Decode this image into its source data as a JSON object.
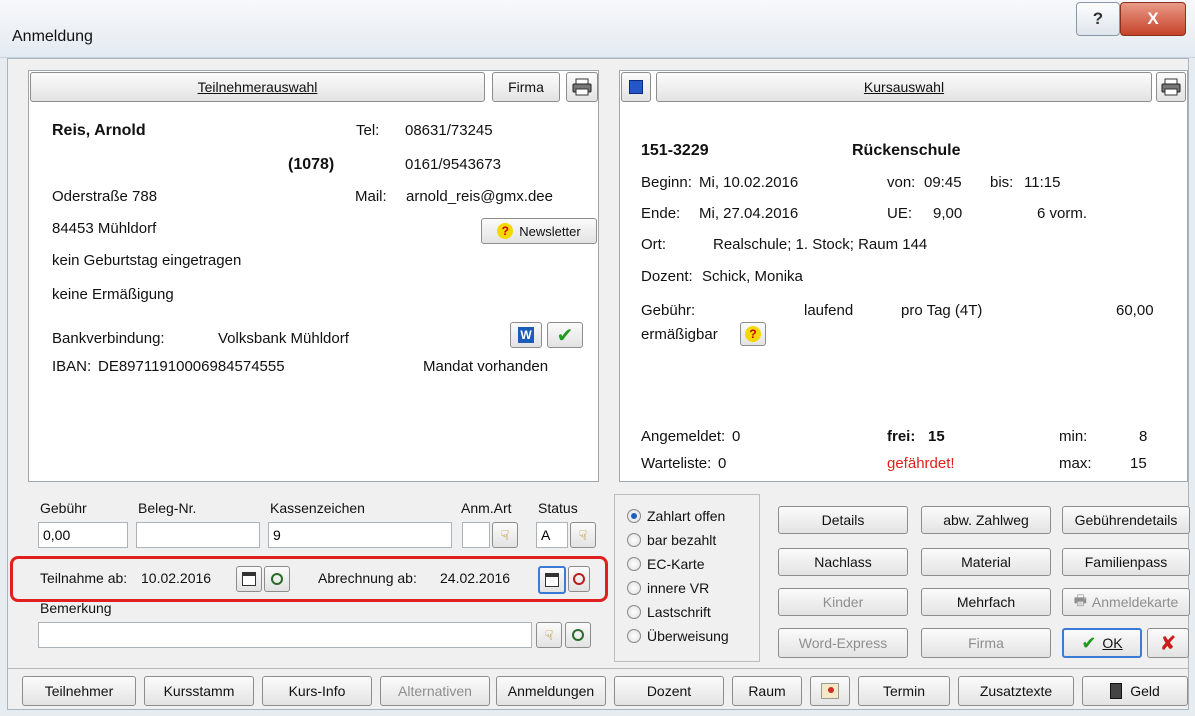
{
  "window": {
    "title": "Anmeldung",
    "help_glyph": "?",
    "close_glyph": "X"
  },
  "participant": {
    "select_button": "Teilnehmerauswahl",
    "firma_button": "Firma",
    "name": "Reis, Arnold",
    "id": "(1078)",
    "tel_label": "Tel:",
    "tel1": "08631/73245",
    "tel2": "0161/9543673",
    "street": "Oderstraße 788",
    "mail_label": "Mail:",
    "mail": "arnold_reis@gmx.dee",
    "city": "84453 Mühldorf",
    "newsletter_label": "Newsletter",
    "birthday": "kein Geburtstag eingetragen",
    "discount": "keine Ermäßigung",
    "bank_label": "Bankverbindung:",
    "bank_name": "Volksbank Mühldorf",
    "iban_label": "IBAN:",
    "iban": "DE89711910006984574555",
    "mandate": "Mandat vorhanden"
  },
  "course": {
    "select_button": "Kursauswahl",
    "number": "151-3229",
    "title": "Rückenschule",
    "begin_label": "Beginn:",
    "begin": "Mi, 10.02.2016",
    "from_label": "von:",
    "from": "09:45",
    "to_label": "bis:",
    "to": "11:15",
    "end_label": "Ende:",
    "end": "Mi, 27.04.2016",
    "ue_label": "UE:",
    "ue": "9,00",
    "slot": "6 vorm.",
    "place_label": "Ort:",
    "place": "Realschule; 1. Stock; Raum 144",
    "teacher_label": "Dozent:",
    "teacher": "Schick, Monika",
    "fee_label": "Gebühr:",
    "fee_type": "laufend",
    "fee_unit": "pro Tag (4T)",
    "fee_amount": "60,00",
    "reducible": "ermäßigbar",
    "registered_label": "Angemeldet:",
    "registered": "0",
    "free_label": "frei:",
    "free": "15",
    "min_label": "min:",
    "min": "8",
    "waitlist_label": "Warteliste:",
    "waitlist": "0",
    "status": "gefährdet!",
    "max_label": "max:",
    "max": "15"
  },
  "form": {
    "fee_label": "Gebühr",
    "fee_value": "0,00",
    "receipt_label": "Beleg-Nr.",
    "receipt_value": "",
    "cash_label": "Kassenzeichen",
    "cash_value": "9",
    "regtype_label": "Anm.Art",
    "regtype_value": "",
    "status_label": "Status",
    "status_value": "A",
    "participation_label": "Teilnahme ab:",
    "participation_date": "10.02.2016",
    "billing_label": "Abrechnung ab:",
    "billing_date": "24.02.2016",
    "remark_label": "Bemerkung",
    "remark_value": ""
  },
  "payment_options": [
    {
      "label": "Zahlart offen",
      "checked": true
    },
    {
      "label": "bar bezahlt",
      "checked": false
    },
    {
      "label": "EC-Karte",
      "checked": false
    },
    {
      "label": "innere VR",
      "checked": false
    },
    {
      "label": "Lastschrift",
      "checked": false
    },
    {
      "label": "Überweisung",
      "checked": false
    }
  ],
  "action_buttons": {
    "details": "Details",
    "alt_payment": "abw. Zahlweg",
    "fee_details": "Gebührendetails",
    "discount": "Nachlass",
    "material": "Material",
    "family_pass": "Familienpass",
    "children": "Kinder",
    "multiple": "Mehrfach",
    "reg_card": "Anmeldekarte",
    "word_express": "Word-Express",
    "company": "Firma",
    "ok": "OK",
    "cancel_glyph": "✘"
  },
  "toolbar": {
    "participants": "Teilnehmer",
    "course_master": "Kursstamm",
    "course_info": "Kurs-Info",
    "alternatives": "Alternativen",
    "registrations": "Anmeldungen",
    "teacher": "Dozent",
    "room": "Raum",
    "schedule": "Termin",
    "extra_texts": "Zusatztexte",
    "money": "Geld"
  },
  "colors": {
    "warning_red": "#e0201e",
    "ok_green": "#1f9a1f",
    "cancel_red": "#c81e1e",
    "focus_blue": "#3a7bd5"
  }
}
